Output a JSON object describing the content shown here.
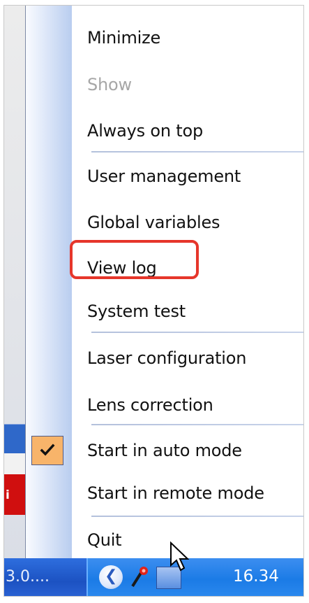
{
  "menu": {
    "items": [
      {
        "label": "Minimize",
        "enabled": true,
        "checked": false
      },
      {
        "label": "Show",
        "enabled": false,
        "checked": false
      },
      {
        "label": "Always on top",
        "enabled": true,
        "checked": false
      },
      {
        "label": "User management",
        "enabled": true,
        "checked": false
      },
      {
        "label": "Global variables",
        "enabled": true,
        "checked": false
      },
      {
        "label": "View log",
        "enabled": true,
        "checked": false,
        "highlighted": true
      },
      {
        "label": "System test",
        "enabled": true,
        "checked": false
      },
      {
        "label": "Laser configuration",
        "enabled": true,
        "checked": false
      },
      {
        "label": "Lens correction",
        "enabled": true,
        "checked": false
      },
      {
        "label": "Start in auto mode",
        "enabled": true,
        "checked": true
      },
      {
        "label": "Start in remote mode",
        "enabled": true,
        "checked": false
      },
      {
        "label": "Quit",
        "enabled": true,
        "checked": false
      }
    ]
  },
  "background_window": {
    "fragment_text": "i"
  },
  "taskbar": {
    "left_text": "3.0....",
    "clock": "16.34",
    "tray_icons": [
      "chevron-left-icon",
      "app-tray-icon",
      "network-icon"
    ]
  },
  "colors": {
    "highlight_outline": "#e6362b",
    "check_background": "#f8b46a",
    "taskbar": "#1c52c2"
  }
}
